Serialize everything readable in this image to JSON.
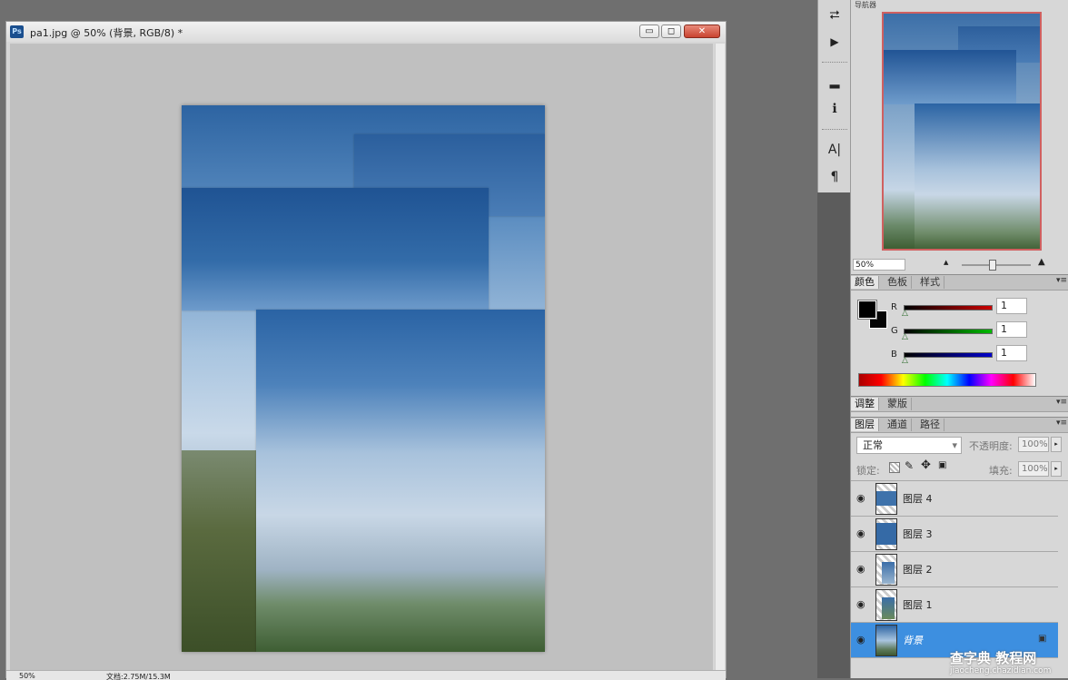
{
  "document": {
    "title": "pa1.jpg @ 50% (背景, RGB/8) *",
    "app_icon": "Ps",
    "status_zoom": "50%",
    "status_info": "文档:2.75M/15.3M",
    "buttons": {
      "minimize_glyph": "▭",
      "maximize_glyph": "◻",
      "close_glyph": "✕"
    }
  },
  "toolstrip": {
    "icons": [
      "history-icon",
      "actions-icon",
      "histogram-icon",
      "info-icon",
      "character-icon",
      "paragraph-icon"
    ],
    "glyphs": {
      "history": "⮂",
      "actions": "▶",
      "histogram": "▂",
      "info": "ℹ",
      "character": "A|",
      "paragraph": "¶"
    }
  },
  "navigator": {
    "tab_label": "导航器",
    "zoom_value": "50%",
    "zoom_out_glyph": "▲",
    "zoom_in_glyph": "▲"
  },
  "color_panel": {
    "tabs": [
      "颜色",
      "色板",
      "样式"
    ],
    "channels": [
      {
        "label": "R",
        "value": "1",
        "color": "#cc0000"
      },
      {
        "label": "G",
        "value": "1",
        "color": "#00bb00"
      },
      {
        "label": "B",
        "value": "1",
        "color": "#0000cc"
      }
    ],
    "menu_glyph": "▾≡"
  },
  "adjust_panel": {
    "tabs": [
      "调整",
      "蒙版"
    ],
    "menu_glyph": "▾≡"
  },
  "layers_panel": {
    "tabs": [
      "图层",
      "通道",
      "路径"
    ],
    "blend_mode": "正常",
    "opacity_label": "不透明度:",
    "opacity_value": "100%",
    "lock_label": "锁定:",
    "fill_label": "填充:",
    "fill_value": "100%",
    "layers": [
      {
        "name": "图层 4",
        "selected": false,
        "locked": false
      },
      {
        "name": "图层 3",
        "selected": false,
        "locked": false
      },
      {
        "name": "图层 2",
        "selected": false,
        "locked": false
      },
      {
        "name": "图层 1",
        "selected": false,
        "locked": false
      },
      {
        "name": "背景",
        "selected": true,
        "locked": true
      }
    ],
    "eye_glyph": "👁",
    "lock_glyph": "🔒",
    "menu_glyph": "▾≡"
  },
  "watermark": {
    "line1": "查字典 教程网",
    "line2": "jiaocheng.chazidian.com"
  }
}
